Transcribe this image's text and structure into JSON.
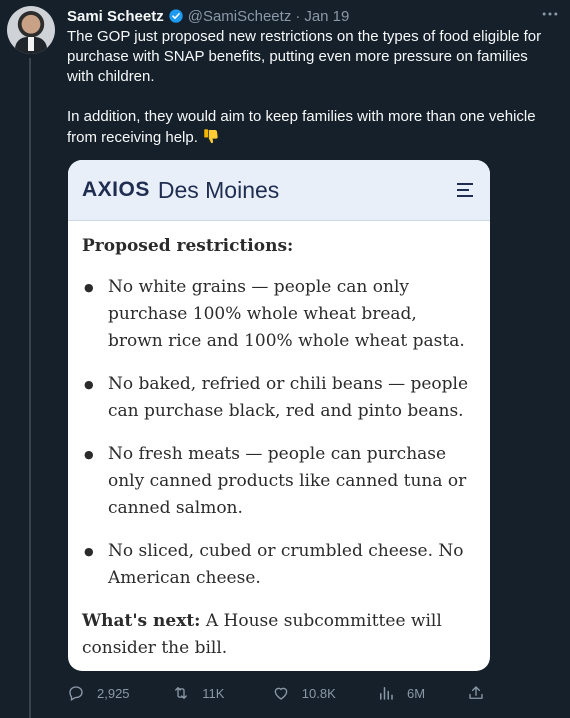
{
  "author": {
    "name": "Sami Scheetz",
    "handle": "@SamiScheetz",
    "separator": "·",
    "date": "Jan 19"
  },
  "tweet": {
    "paragraph1": "The GOP just proposed new restrictions on the types of food eligible for purchase with SNAP benefits, putting even more pressure on families with children.",
    "paragraph2": "In addition, they would aim to keep families with more than one vehicle from receiving help.",
    "emoji": "thumbs-down-icon"
  },
  "card": {
    "logo": "AXIOS",
    "city": "Des Moines",
    "heading": "Proposed restrictions:",
    "items": [
      "No white grains — people can only purchase 100% whole wheat bread, brown rice and 100% whole wheat pasta.",
      "No baked, refried or chili beans — people can purchase black, red and pinto beans.",
      "No fresh meats — people can purchase only canned products like canned tuna or canned salmon.",
      "No sliced, cubed or crumbled cheese. No American cheese."
    ],
    "next_label": "What's next:",
    "next_text": " A House subcommittee will consider the bill."
  },
  "actions": {
    "replies": "2,925",
    "retweets": "11K",
    "likes": "10.8K",
    "views": "6M"
  },
  "colors": {
    "background": "#15202b",
    "text": "#f7f9f9",
    "muted": "#8b98a5",
    "verified": "#1d9bf0",
    "axios_header": "#e8eff8"
  }
}
